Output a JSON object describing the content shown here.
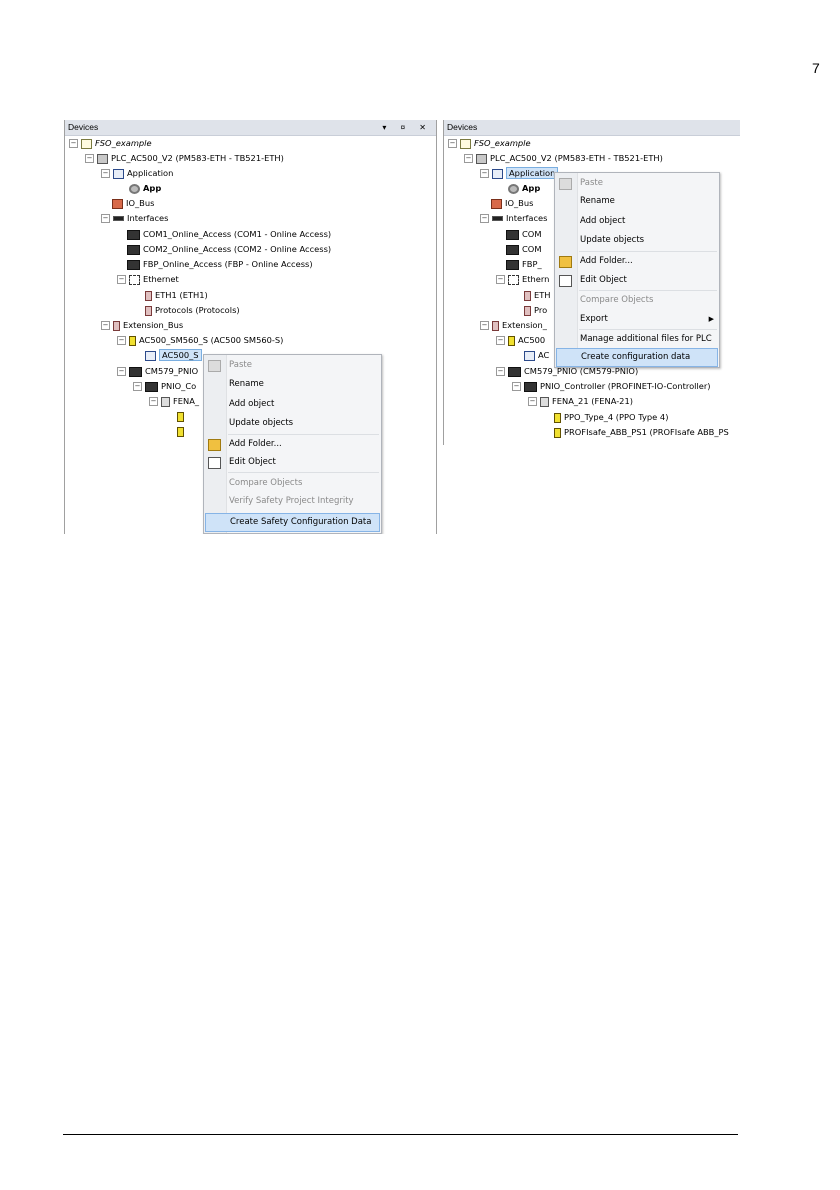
{
  "page_number": "7",
  "left_panel": {
    "title": "Devices",
    "title_icons": "▾ ¤ ✕",
    "tree": {
      "project": "FSO_example",
      "plc": "PLC_AC500_V2 (PM583-ETH - TB521-ETH)",
      "application": "Application",
      "app": "App",
      "io_bus": "IO_Bus",
      "interfaces": "Interfaces",
      "com1": "COM1_Online_Access (COM1 - Online Access)",
      "com2": "COM2_Online_Access (COM2 - Online Access)",
      "fbp": "FBP_Online_Access (FBP - Online Access)",
      "ethernet": "Ethernet",
      "eth1": "ETH1 (ETH1)",
      "protocols": "Protocols (Protocols)",
      "extension_bus": "Extension_Bus",
      "sm560": "AC500_SM560_S (AC500 SM560-S)",
      "ac500_s": "AC500_S",
      "cm579": "CM579_PNIO",
      "pnio": "PNIO_Co",
      "fena": "FENA_"
    },
    "menu": {
      "paste": "Paste",
      "rename": "Rename",
      "add_object": "Add object",
      "update_objects": "Update objects",
      "add_folder": "Add Folder...",
      "edit_object": "Edit Object",
      "compare_objects": "Compare Objects",
      "verify": "Verify Safety Project Integrity",
      "create_safety": "Create Safety Configuration Data"
    }
  },
  "right_panel": {
    "title": "Devices",
    "tree": {
      "project": "FSO_example",
      "plc": "PLC_AC500_V2 (PM583-ETH - TB521-ETH)",
      "application": "Application",
      "app": "App",
      "io_bus": "IO_Bus",
      "interfaces": "Interfaces",
      "com1": "COM",
      "com2": "COM",
      "fbp": "FBP_",
      "ethernet": "Ethern",
      "eth1": "ETH",
      "protocols": "Pro",
      "extension_bus": "Extension_",
      "ac500": "AC500",
      "ac": "AC",
      "cm579": "CM579_PNIO (CM579-PNIO)",
      "pnio": "PNIO_Controller (PROFINET-IO-Controller)",
      "fena": "FENA_21 (FENA-21)",
      "ppo": "PPO_Type_4 (PPO Type 4)",
      "profisafe": "PROFIsafe_ABB_PS1 (PROFIsafe ABB_PS"
    },
    "menu": {
      "paste": "Paste",
      "rename": "Rename",
      "add_object": "Add object",
      "update_objects": "Update objects",
      "add_folder": "Add Folder...",
      "edit_object": "Edit Object",
      "compare_objects": "Compare Objects",
      "export": "Export",
      "manage_files": "Manage additional files for PLC",
      "create_config": "Create configuration data"
    }
  }
}
